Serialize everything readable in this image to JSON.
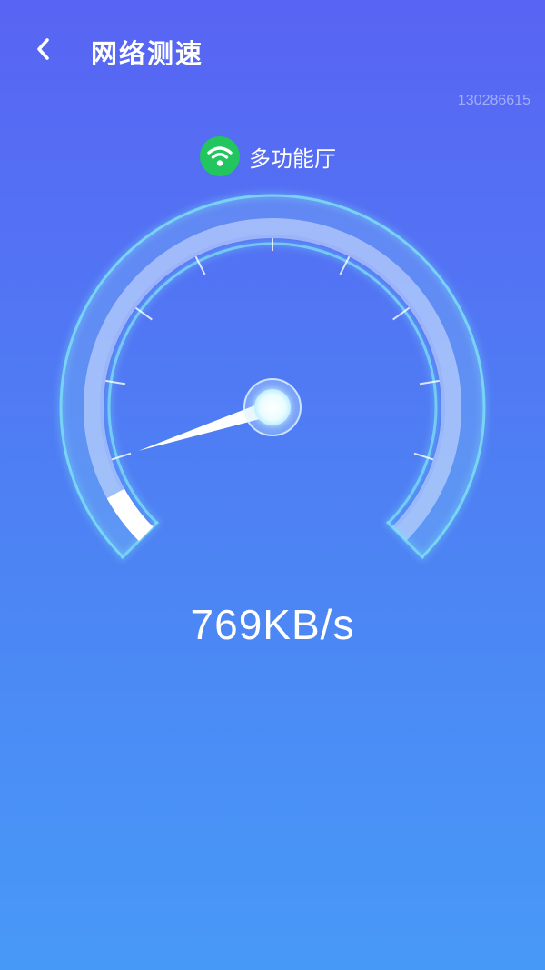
{
  "header": {
    "title": "网络测速",
    "back_icon": "chevron-left-icon"
  },
  "id_label": "130286615",
  "network": {
    "icon": "wifi-icon",
    "icon_color": "#22c55e",
    "name": "多功能厅"
  },
  "gauge": {
    "progress": 0.06,
    "needle_fraction": 0.1
  },
  "speed": {
    "text": "769KB/s"
  },
  "colors": {
    "bg_top": "#5864f3",
    "bg_bottom": "#4799f7",
    "ring_glow": "#7fe4f4"
  }
}
